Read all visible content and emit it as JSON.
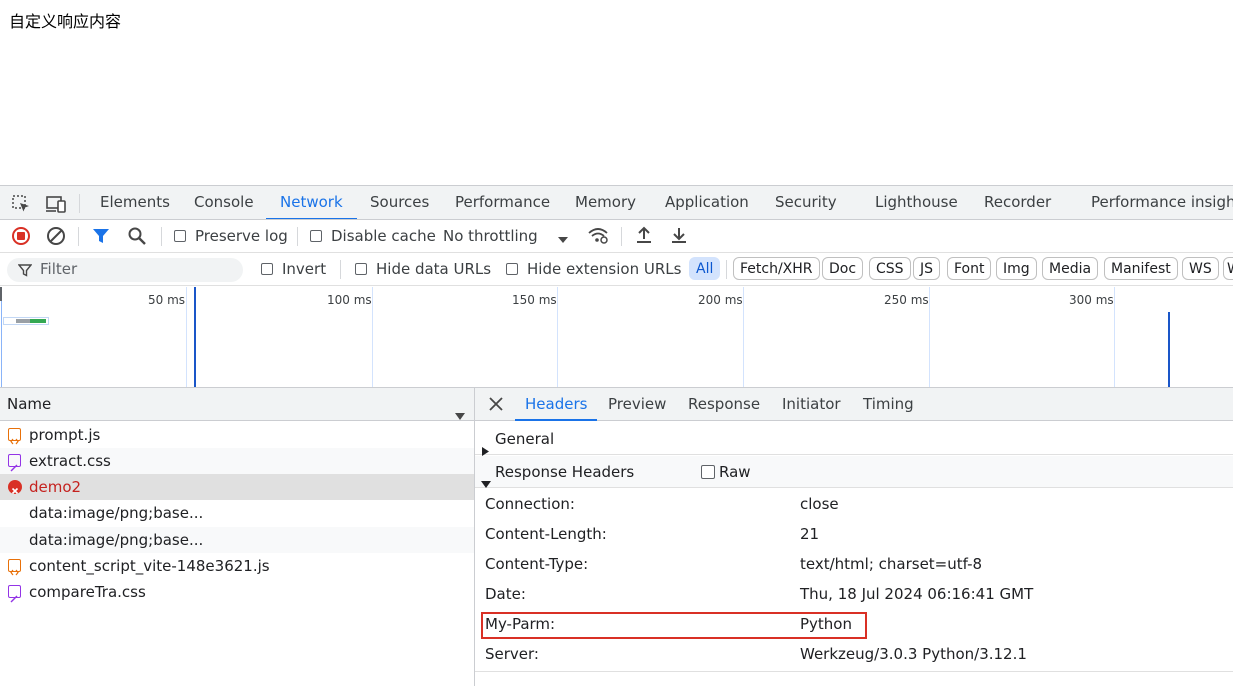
{
  "page": {
    "text": "自定义响应内容"
  },
  "tabs": [
    {
      "label": "Elements"
    },
    {
      "label": "Console"
    },
    {
      "label": "Network"
    },
    {
      "label": "Sources"
    },
    {
      "label": "Performance"
    },
    {
      "label": "Memory"
    },
    {
      "label": "Application"
    },
    {
      "label": "Security"
    },
    {
      "label": "Lighthouse"
    },
    {
      "label": "Recorder"
    },
    {
      "label": "Performance insight"
    }
  ],
  "toolbar": {
    "preserve_log": "Preserve log",
    "disable_cache": "Disable cache",
    "throttling": "No throttling"
  },
  "filterbar": {
    "filter_placeholder": "Filter",
    "invert": "Invert",
    "hide_data_urls": "Hide data URLs",
    "hide_extension_urls": "Hide extension URLs",
    "types": [
      "All",
      "Fetch/XHR",
      "Doc",
      "CSS",
      "JS",
      "Font",
      "Img",
      "Media",
      "Manifest",
      "WS",
      "W"
    ]
  },
  "overview": {
    "ticks": [
      "50 ms",
      "100 ms",
      "150 ms",
      "200 ms",
      "250 ms",
      "300 ms"
    ]
  },
  "requests": {
    "column": "Name",
    "items": [
      {
        "name": "prompt.js",
        "type": "js"
      },
      {
        "name": "extract.css",
        "type": "css"
      },
      {
        "name": "demo2",
        "type": "error"
      },
      {
        "name": "data:image/png;base...",
        "type": "img"
      },
      {
        "name": "data:image/png;base...",
        "type": "img"
      },
      {
        "name": "content_script_vite-148e3621.js",
        "type": "js"
      },
      {
        "name": "compareTra.css",
        "type": "css"
      }
    ]
  },
  "details": {
    "tabs": [
      "Headers",
      "Preview",
      "Response",
      "Initiator",
      "Timing"
    ],
    "general": "General",
    "response_headers": "Response Headers",
    "raw": "Raw",
    "headers": [
      {
        "name": "Connection:",
        "value": "close"
      },
      {
        "name": "Content-Length:",
        "value": "21"
      },
      {
        "name": "Content-Type:",
        "value": "text/html; charset=utf-8"
      },
      {
        "name": "Date:",
        "value": "Thu, 18 Jul 2024 06:16:41 GMT"
      },
      {
        "name": "My-Parm:",
        "value": "Python"
      },
      {
        "name": "Server:",
        "value": "Werkzeug/3.0.3 Python/3.12.1"
      }
    ]
  },
  "colors": {
    "accent": "#1a73e8",
    "error": "#d93025",
    "highlight": "#d93025"
  }
}
